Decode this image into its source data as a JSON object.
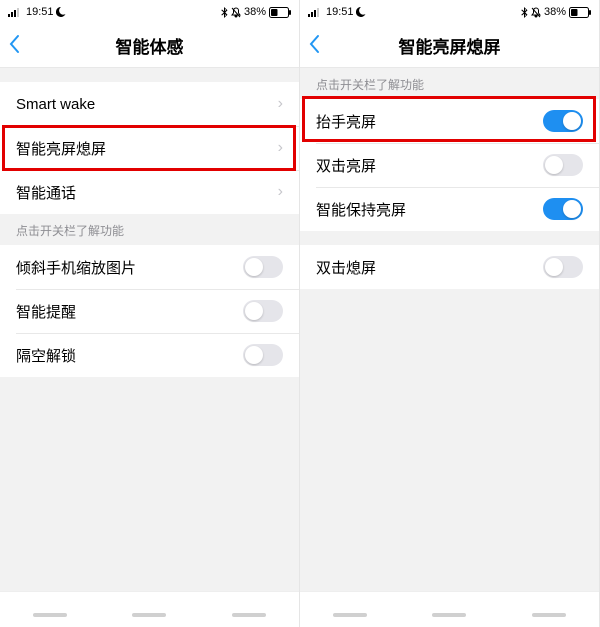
{
  "status": {
    "time": "19:51",
    "battery_pct": "38%"
  },
  "left": {
    "title": "智能体感",
    "group1": [
      {
        "label": "Smart wake",
        "type": "nav"
      },
      {
        "label": "智能亮屏熄屏",
        "type": "nav",
        "highlight": true
      },
      {
        "label": "智能通话",
        "type": "nav"
      }
    ],
    "section_hint": "点击开关栏了解功能",
    "group2": [
      {
        "label": "倾斜手机缩放图片",
        "type": "toggle",
        "on": false
      },
      {
        "label": "智能提醒",
        "type": "toggle",
        "on": false
      },
      {
        "label": "隔空解锁",
        "type": "toggle",
        "on": false
      }
    ]
  },
  "right": {
    "title": "智能亮屏熄屏",
    "section_hint": "点击开关栏了解功能",
    "group1": [
      {
        "label": "抬手亮屏",
        "type": "toggle",
        "on": true,
        "highlight": true
      },
      {
        "label": "双击亮屏",
        "type": "toggle",
        "on": false
      },
      {
        "label": "智能保持亮屏",
        "type": "toggle",
        "on": true
      }
    ],
    "group2": [
      {
        "label": "双击熄屏",
        "type": "toggle",
        "on": false
      }
    ]
  }
}
